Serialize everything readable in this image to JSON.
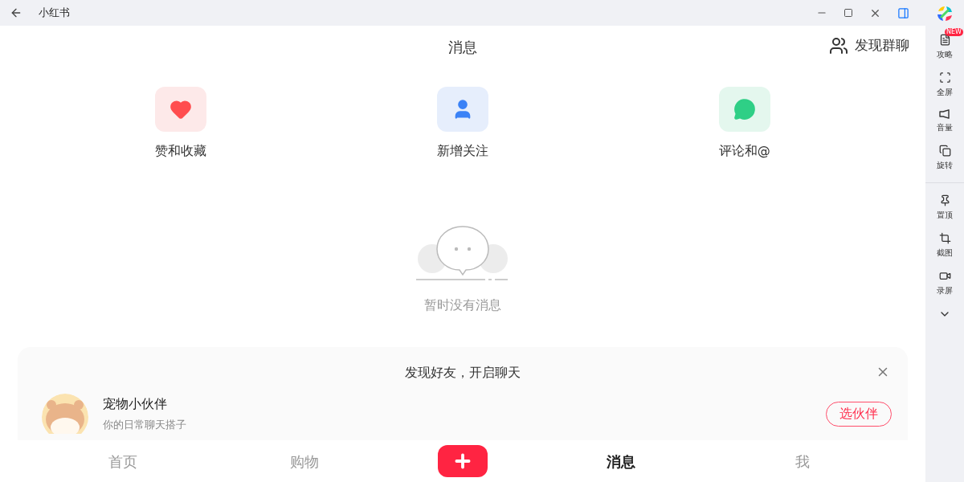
{
  "window": {
    "title": "小红书"
  },
  "header": {
    "title": "消息",
    "action": "发现群聊"
  },
  "shortcuts": [
    {
      "label": "赞和收藏",
      "kind": "likes"
    },
    {
      "label": "新增关注",
      "kind": "follows"
    },
    {
      "label": "评论和@",
      "kind": "comments"
    }
  ],
  "empty_state": {
    "text": "暂时没有消息"
  },
  "suggest_card": {
    "title": "发现好友，开启聊天",
    "contact": {
      "name": "宠物小伙伴",
      "subtitle": "你的日常聊天搭子",
      "button": "选伙伴"
    }
  },
  "bottom_nav": [
    {
      "kind": "tab",
      "label": "首页",
      "selected": false
    },
    {
      "kind": "tab",
      "label": "购物",
      "selected": false
    },
    {
      "kind": "add"
    },
    {
      "kind": "tab",
      "label": "消息",
      "selected": true
    },
    {
      "kind": "tab",
      "label": "我",
      "selected": false
    }
  ],
  "sidebar": {
    "groups": [
      [
        {
          "label": "攻略",
          "badge": "NEW"
        },
        {
          "label": "全屏"
        },
        {
          "label": "音量"
        },
        {
          "label": "旋转"
        }
      ],
      [
        {
          "label": "置顶"
        },
        {
          "label": "截图"
        },
        {
          "label": "录屏"
        }
      ]
    ]
  }
}
